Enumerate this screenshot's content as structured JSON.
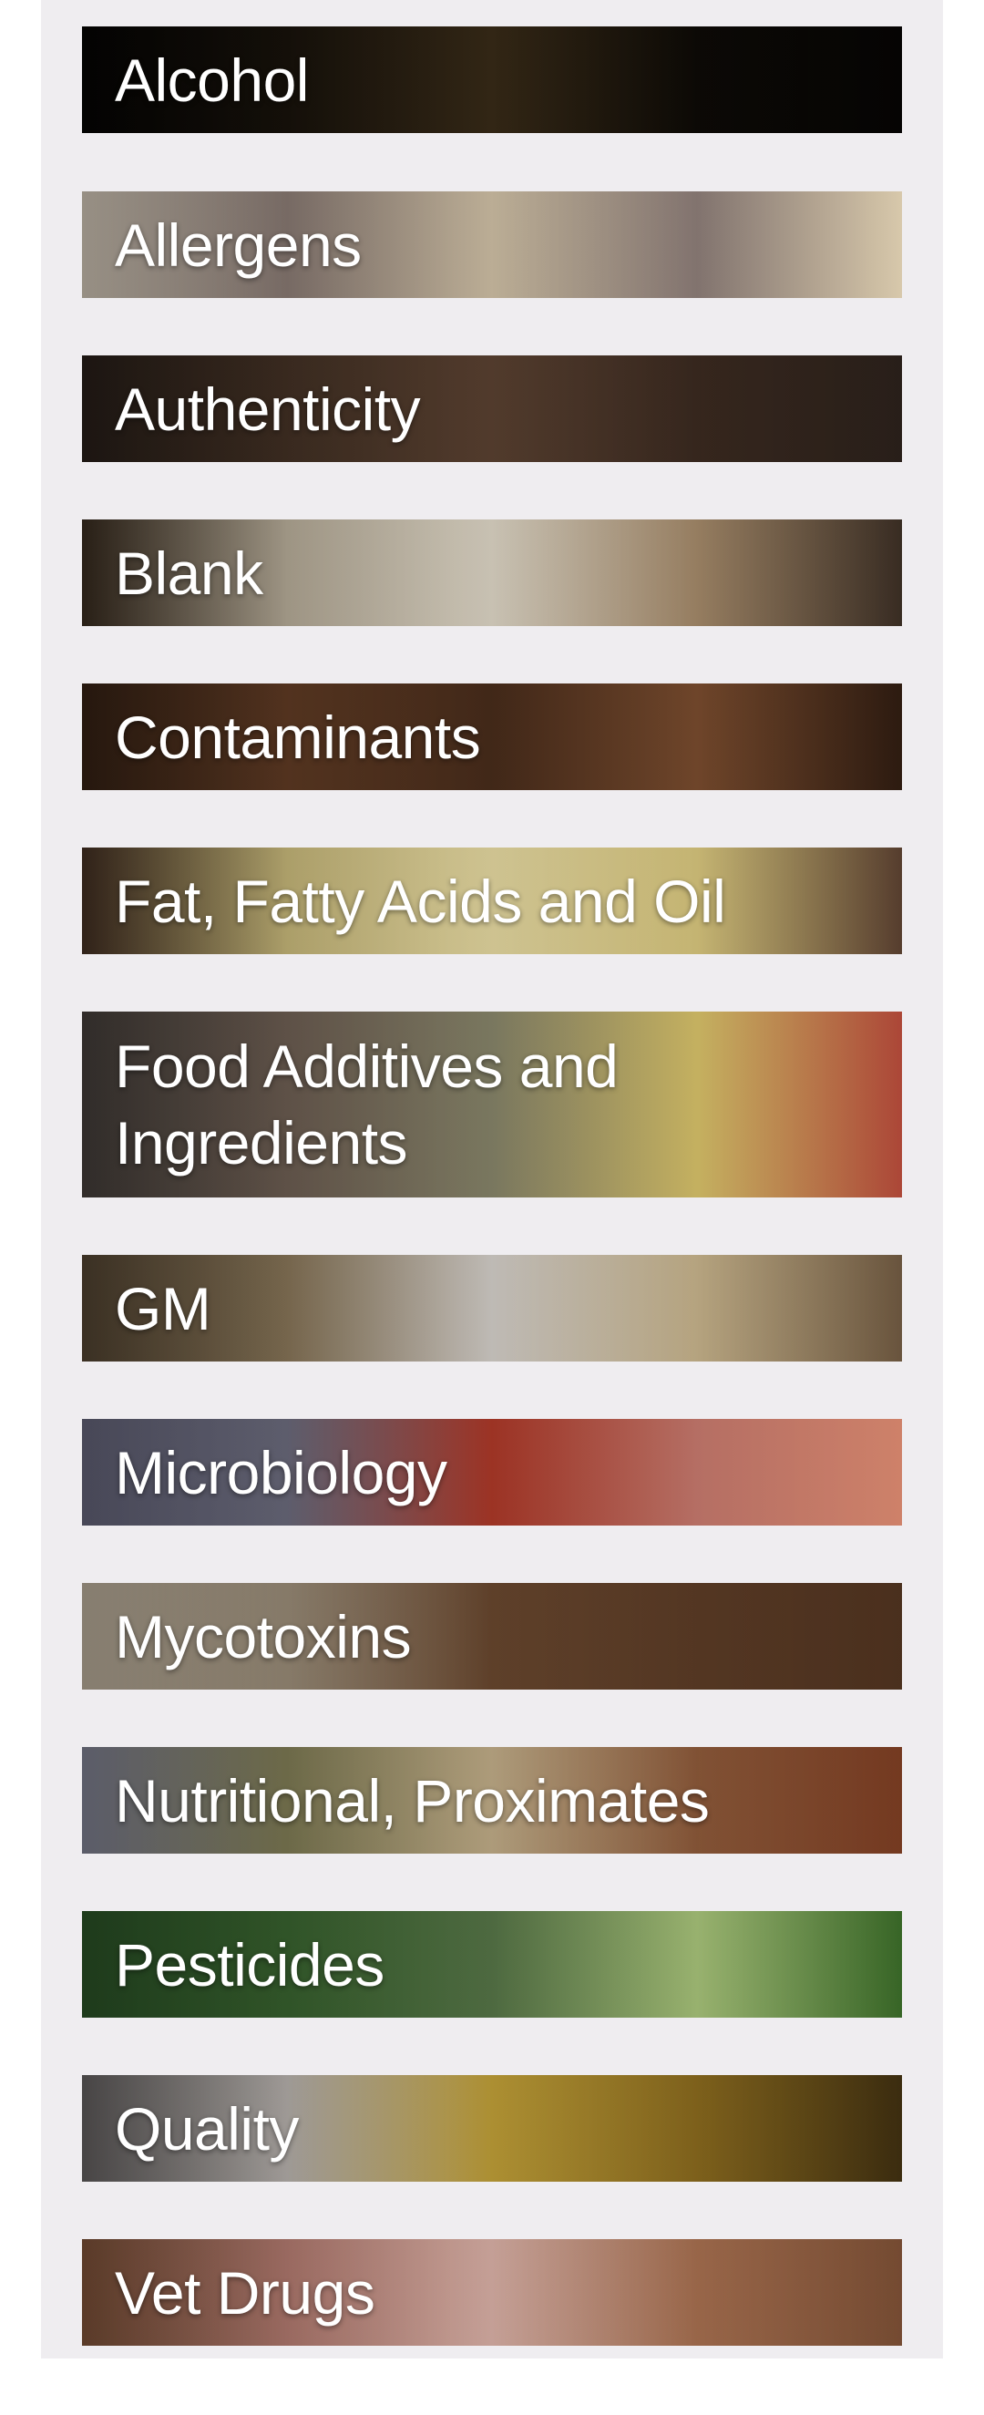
{
  "categories": [
    {
      "label": "Alcohol",
      "image": "wine-glass-image",
      "colors": [
        "#050403",
        "#1a140c",
        "#3a2c18",
        "#0d0a06",
        "#050403"
      ]
    },
    {
      "label": "Allergens",
      "image": "grain-spoons-image",
      "colors": [
        "#e8dccb",
        "#9c8b83",
        "#d9c9ad",
        "#8f7f7a",
        "#e3d3b4"
      ]
    },
    {
      "label": "Authenticity",
      "image": "raw-meat-board-image",
      "colors": [
        "#2b211b",
        "#4a3628",
        "#5e4433",
        "#3b2a20",
        "#2a201a"
      ]
    },
    {
      "label": "Blank",
      "image": "flour-bowl-image",
      "colors": [
        "#3e3022",
        "#cfc3ad",
        "#e8e0cf",
        "#a58a6a",
        "#3b2e24"
      ]
    },
    {
      "label": "Contaminants",
      "image": "coffee-beans-image",
      "colors": [
        "#3a2416",
        "#6b4228",
        "#4b2e1c",
        "#7a4c2e",
        "#2f1c11"
      ]
    },
    {
      "label": "Fat, Fatty Acids and Oil",
      "image": "butter-bowl-image",
      "colors": [
        "#4a3426",
        "#e1d08a",
        "#efe2a8",
        "#d9c77e",
        "#5a4030"
      ]
    },
    {
      "label": "Food Additives and\nIngredients",
      "image": "spices-herbs-image",
      "colors": [
        "#4b4440",
        "#7b6a5d",
        "#8d8a6e",
        "#d9c36a",
        "#b54a3a"
      ]
    },
    {
      "label": "GM",
      "image": "sack-flour-image",
      "colors": [
        "#5a4a36",
        "#9a8564",
        "#ddd8d2",
        "#c8b48c",
        "#6e5840"
      ]
    },
    {
      "label": "Microbiology",
      "image": "tomato-meat-image",
      "colors": [
        "#6e6e86",
        "#7a7a8e",
        "#b53b2a",
        "#c87a6e",
        "#d9886f"
      ]
    },
    {
      "label": "Mycotoxins",
      "image": "oats-wood-image",
      "colors": [
        "#cfc2ad",
        "#b0a089",
        "#6d4a30",
        "#5c3c26",
        "#4e321f"
      ]
    },
    {
      "label": "Nutritional, Proximates",
      "image": "nuts-seeds-image",
      "colors": [
        "#8c8ea2",
        "#8e8a5e",
        "#c9b48e",
        "#8e5a3a",
        "#7a3c22"
      ]
    },
    {
      "label": "Pesticides",
      "image": "vegetables-image",
      "colors": [
        "#2e5a2a",
        "#3f6e34",
        "#5a7a4a",
        "#a8c47a",
        "#3a6a28"
      ]
    },
    {
      "label": "Quality",
      "image": "olive-oil-pour-image",
      "colors": [
        "#6e6a6a",
        "#cfc9c4",
        "#c8a63a",
        "#8a6a1e",
        "#3e2e10"
      ]
    },
    {
      "label": "Vet Drugs",
      "image": "raw-chicken-image",
      "colors": [
        "#8a5a3e",
        "#c98a7e",
        "#e4b9ae",
        "#a87050",
        "#7a4e34"
      ]
    }
  ]
}
